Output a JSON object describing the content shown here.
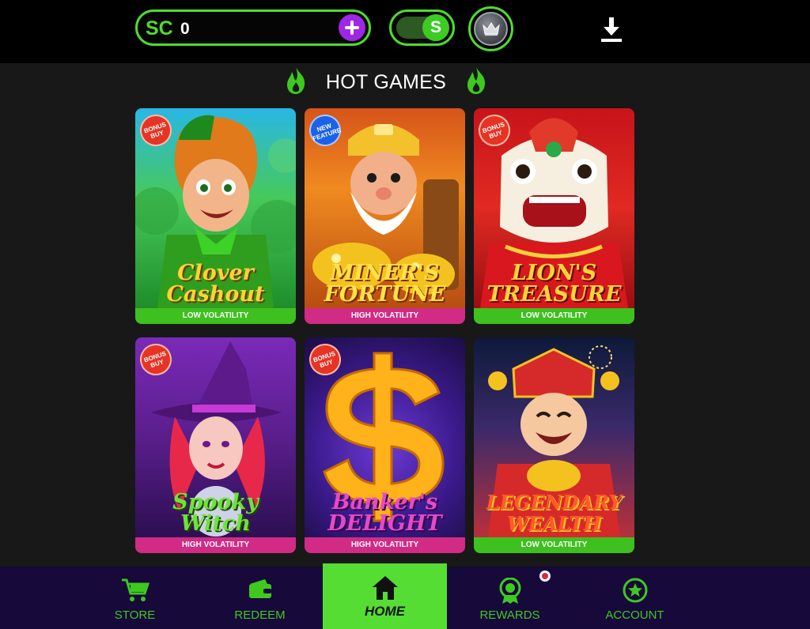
{
  "topbar": {
    "currency_label": "SC",
    "balance": "0",
    "toggle_label": "S"
  },
  "section": {
    "title": "HOT GAMES"
  },
  "games": [
    {
      "name_line1": "Clover",
      "name_line2": "Cashout",
      "badge": "BONUS BUY",
      "volatility": "LOW VOLATILITY"
    },
    {
      "name_line1": "MINER'S",
      "name_line2": "FORTUNE",
      "badge": "NEW FEATURE",
      "volatility": "HIGH VOLATILITY"
    },
    {
      "name_line1": "LION'S",
      "name_line2": "TREASURE",
      "badge": "BONUS BUY",
      "volatility": "LOW VOLATILITY"
    },
    {
      "name_line1": "Spooky",
      "name_line2": "Witch",
      "badge": "BONUS BUY",
      "volatility": "HIGH VOLATILITY"
    },
    {
      "name_line1": "Banker's",
      "name_line2": "DELIGHT",
      "badge": "BONUS BUY",
      "volatility": "HIGH VOLATILITY"
    },
    {
      "name_line1": "LEGENDARY",
      "name_line2": "WEALTH",
      "badge": "",
      "volatility": "LOW VOLATILITY"
    }
  ],
  "nav": {
    "store": "STORE",
    "redeem": "REDEEM",
    "home": "HOME",
    "rewards": "REWARDS",
    "account": "ACCOUNT"
  },
  "colors": {
    "accent_green": "#4fdc2c",
    "plus_purple": "#a026e6",
    "low_volatility": "#3ec01f",
    "high_volatility": "#d12b85",
    "nav_bg": "#17093a"
  },
  "icons": [
    "plus-icon",
    "crown-icon",
    "download-icon",
    "flame-icon",
    "cart-icon",
    "wallet-icon",
    "home-icon",
    "medal-icon",
    "star-icon"
  ]
}
